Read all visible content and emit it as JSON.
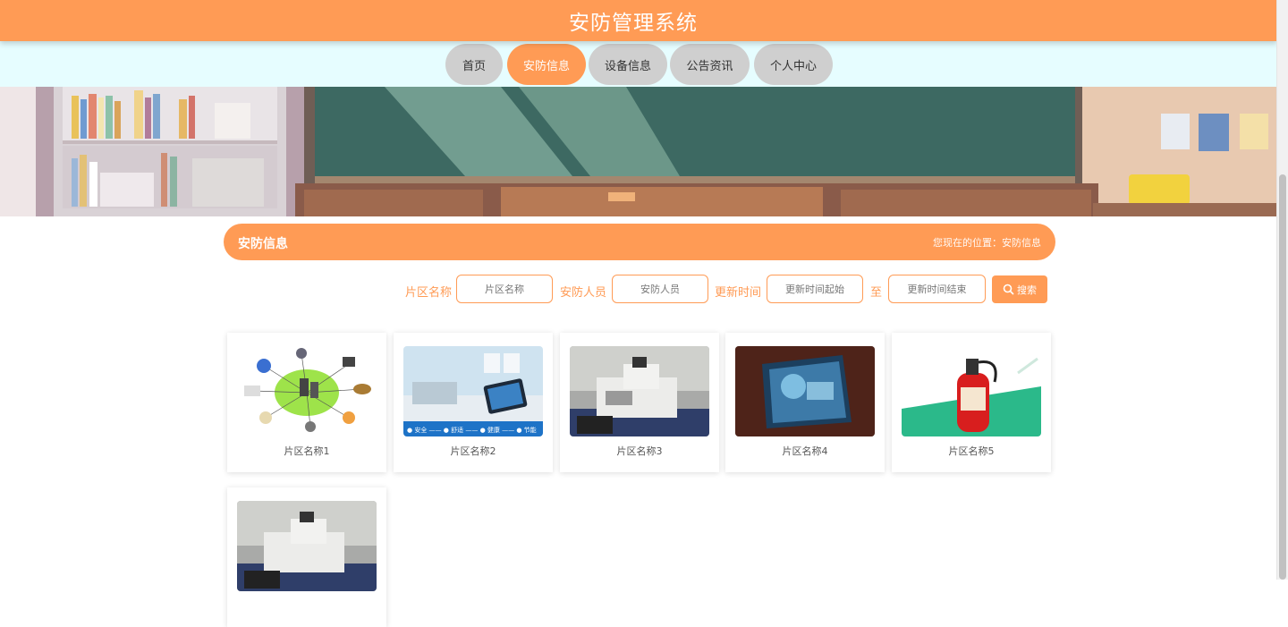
{
  "header": {
    "title": "安防管理系统"
  },
  "nav": {
    "items": [
      {
        "label": "首页"
      },
      {
        "label": "安防信息"
      },
      {
        "label": "设备信息"
      },
      {
        "label": "公告资讯"
      },
      {
        "label": "个人中心"
      }
    ],
    "active": "安防信息"
  },
  "section": {
    "title": "安防信息",
    "breadcrumb": "您现在的位置：安防信息"
  },
  "search": {
    "zone_label": "片区名称",
    "zone_placeholder": "片区名称",
    "staff_label": "安防人员",
    "staff_placeholder": "安防人员",
    "time_label": "更新时间",
    "time_start_placeholder": "更新时间起始",
    "to_label": "至",
    "time_end_placeholder": "更新时间结束",
    "button_label": "搜索"
  },
  "cards": [
    {
      "name": "片区名称1",
      "image": "security-network-diagram"
    },
    {
      "name": "片区名称2",
      "image": "smart-home-tablet"
    },
    {
      "name": "片区名称3",
      "image": "lab-equipment"
    },
    {
      "name": "片区名称4",
      "image": "digital-display"
    },
    {
      "name": "片区名称5",
      "image": "fire-extinguisher"
    },
    {
      "name": "",
      "image": "lab-equipment"
    }
  ],
  "colors": {
    "accent": "#ff9b55",
    "nav_bg": "#e6fdff",
    "nav_inactive": "#cfcfcf"
  }
}
